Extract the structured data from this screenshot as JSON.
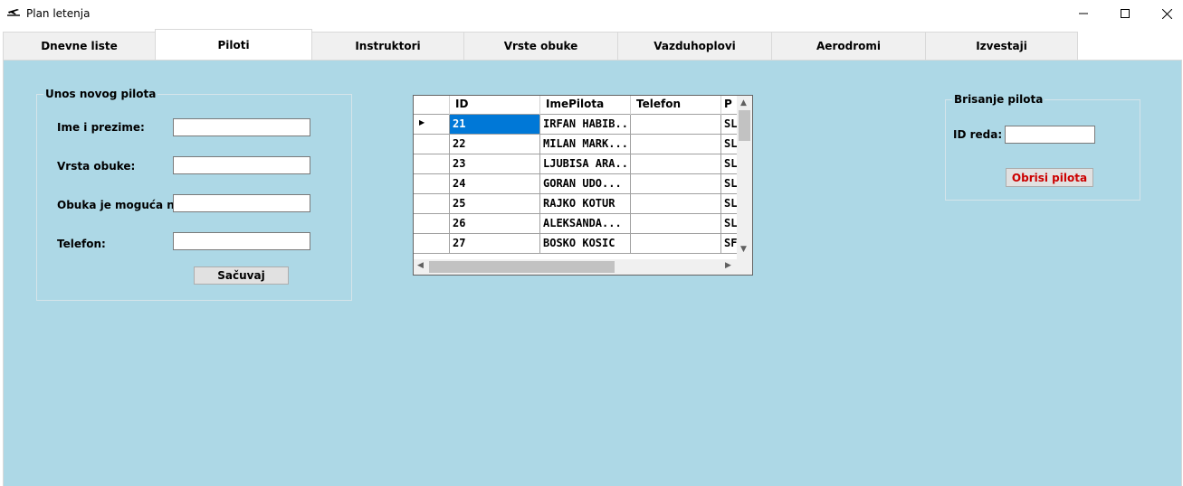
{
  "window": {
    "title": "Plan letenja"
  },
  "tabs": [
    {
      "label": "Dnevne liste"
    },
    {
      "label": "Piloti"
    },
    {
      "label": "Instruktori"
    },
    {
      "label": "Vrste obuke"
    },
    {
      "label": "Vazduhoplovi"
    },
    {
      "label": "Aerodromi"
    },
    {
      "label": "Izvestaji"
    }
  ],
  "active_tab": "Piloti",
  "new_pilot": {
    "group_title": "Unos novog pilota",
    "name_label": "Ime i prezime:",
    "training_label": "Vrsta obuke:",
    "possible_label": "Obuka je moguća na:",
    "phone_label": "Telefon:",
    "name_value": "",
    "training_value": "",
    "possible_value": "",
    "phone_value": "",
    "save_label": "Sačuvaj"
  },
  "grid": {
    "columns": [
      "ID",
      "ImePilota",
      "Telefon",
      "P"
    ],
    "rows": [
      [
        "21",
        "IRFAN HABIB...",
        "",
        "SL"
      ],
      [
        "22",
        "MILAN MARK...",
        "",
        "SL"
      ],
      [
        "23",
        "LJUBISA ARA...",
        "",
        "SL"
      ],
      [
        "24",
        "GORAN UDO...",
        "",
        "SL"
      ],
      [
        "25",
        "RAJKO KOTUR",
        "",
        "SL"
      ],
      [
        "26",
        "ALEKSANDA...",
        "",
        "SL"
      ],
      [
        "27",
        "BOSKO KOSIC",
        "",
        "SF"
      ]
    ],
    "selected_row": 0
  },
  "delete_pilot": {
    "group_title": "Brisanje pilota",
    "id_label": "ID reda:",
    "id_value": "",
    "delete_label": "Obrisi pilota"
  },
  "colors": {
    "panel": "#add8e6",
    "selection": "#0078d7",
    "delete_text": "#cc0000"
  }
}
